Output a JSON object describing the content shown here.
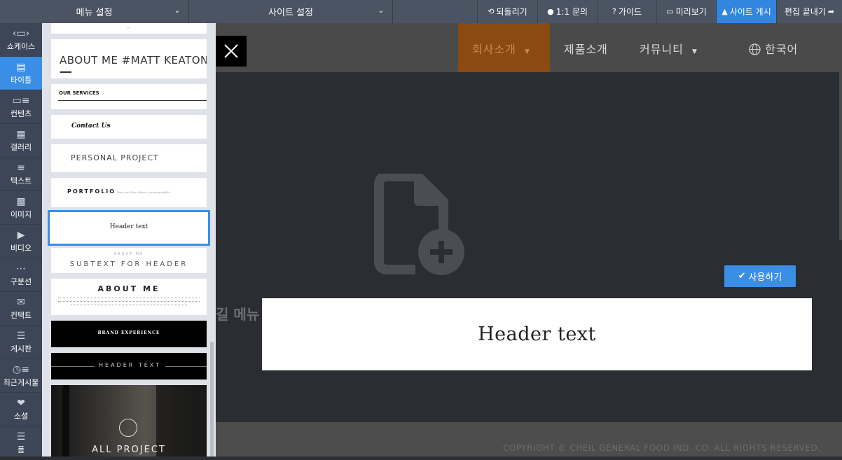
{
  "toolbar": {
    "menu_settings": "메뉴 설정",
    "site_settings": "사이트 설정",
    "undo": "되돌리기",
    "inquiry": "1:1 문의",
    "guide": "가이드",
    "preview": "미리보기",
    "publish": "사이트 게시",
    "finish": "편집 끝내기",
    "accent_color": "#3385e0"
  },
  "rail": {
    "items": [
      {
        "label": "쇼케이스",
        "icon": "showcase-icon"
      },
      {
        "label": "타이틀",
        "icon": "title-icon",
        "active": true
      },
      {
        "label": "컨텐츠",
        "icon": "content-icon"
      },
      {
        "label": "갤러리",
        "icon": "gallery-icon"
      },
      {
        "label": "텍스트",
        "icon": "text-icon"
      },
      {
        "label": "이미지",
        "icon": "image-icon"
      },
      {
        "label": "비디오",
        "icon": "video-icon"
      },
      {
        "label": "구분선",
        "icon": "divider-icon"
      },
      {
        "label": "컨택트",
        "icon": "mail-icon"
      },
      {
        "label": "게시판",
        "icon": "board-icon"
      },
      {
        "label": "최근게시물",
        "icon": "recent-posts-icon"
      },
      {
        "label": "소셜",
        "icon": "social-icon"
      },
      {
        "label": "폼",
        "icon": "form-icon"
      }
    ]
  },
  "templates": {
    "about_me_matt": "ABOUT ME #MATT KEATON",
    "our_services": "OUR SERVICES",
    "contact_us": "Contact Us",
    "personal_project": "PERSONAL PROJECT",
    "portfolio": "PORTFOLIO",
    "portfolio_sub": "Your text here about a great portfolio",
    "header_text": "Header text",
    "about_me_small": "ABOUT ME",
    "subtext_for_header": "SUBTEXT FOR HEADER",
    "about_me_big": "ABOUT ME",
    "brand_experience": "BRAND EXPERIENCE",
    "header_text_caps": "HEADER TEXT",
    "all_project": "ALL PROJECT"
  },
  "canvas": {
    "nav": {
      "company": "회사소개",
      "products": "제품소개",
      "community": "커뮤니티",
      "language": "한국어"
    },
    "ghost_text": "길 메뉴",
    "use_button": "사용하기",
    "preview_text": "Header text",
    "footer": "COPYRIGHT © CHEIL GENERAL FOOD IND. CO. ALL RIGHTS RESERVED."
  }
}
